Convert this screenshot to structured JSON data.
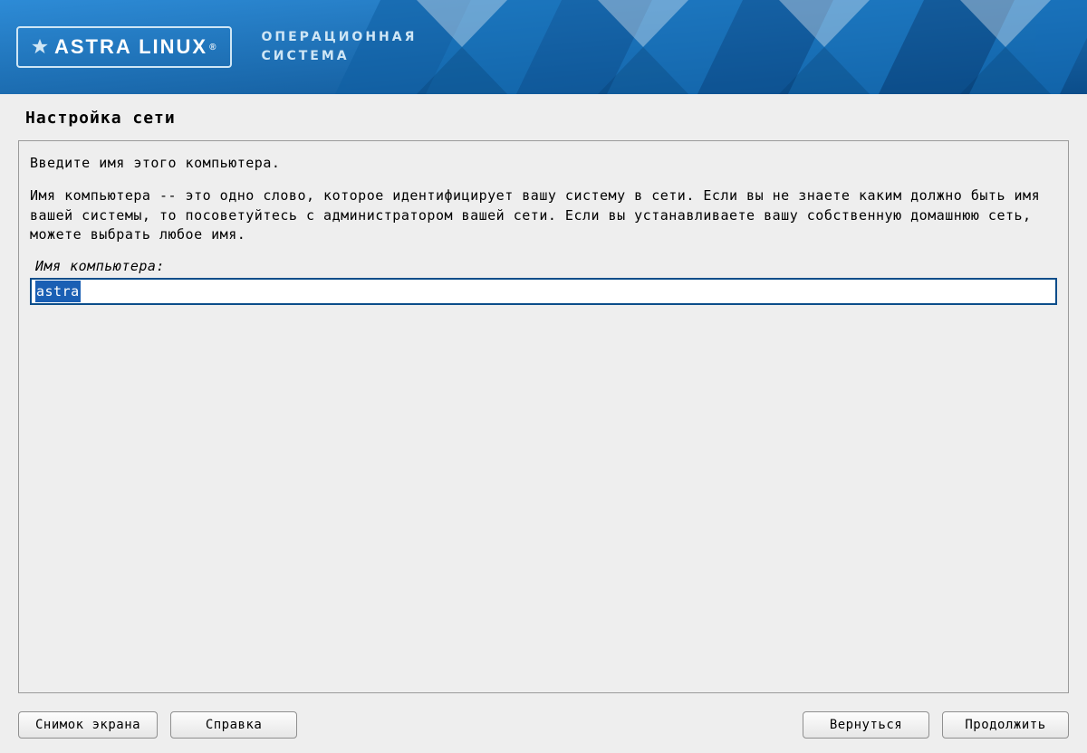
{
  "header": {
    "logo_text": "ASTRA LINUX",
    "logo_registered": "®",
    "subtitle_line1": "ОПЕРАЦИОННАЯ",
    "subtitle_line2": "СИСТЕМА"
  },
  "page": {
    "section_title": "Настройка сети"
  },
  "panel": {
    "intro": "Введите имя этого компьютера.",
    "help_text": "Имя компьютера -- это одно слово, которое идентифицирует вашу систему в сети. Если вы не знаете каким должно быть имя вашей системы, то посоветуйтесь с администратором вашей сети. Если вы устанавливаете вашу собственную домашнюю сеть, можете выбрать любое имя.",
    "field_label": "Имя компьютера:",
    "hostname_value": "astra"
  },
  "buttons": {
    "screenshot": "Снимок экрана",
    "help": "Справка",
    "back": "Вернуться",
    "continue": "Продолжить"
  }
}
